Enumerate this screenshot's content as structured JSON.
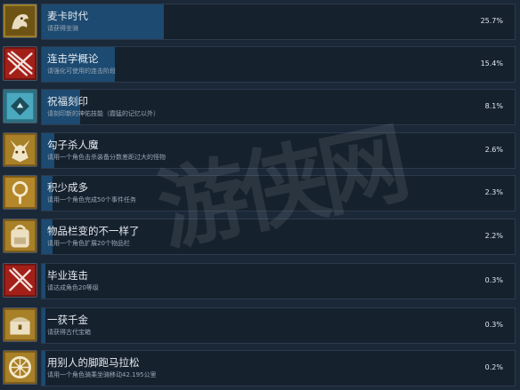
{
  "achievements": [
    {
      "name": "麦卡时代",
      "desc": "请获得坐骑",
      "percent": "25.7%",
      "fill": 0.257,
      "icon": "creature-badge-icon"
    },
    {
      "name": "连击学概论",
      "desc": "请强化可使用的连击阶段",
      "percent": "15.4%",
      "fill": 0.154,
      "icon": "crossed-claws-icon"
    },
    {
      "name": "祝福刻印",
      "desc": "请刻印新的神佑技能（霞猛的记忆以外）",
      "percent": "8.1%",
      "fill": 0.081,
      "icon": "rune-tile-icon"
    },
    {
      "name": "勾子杀人魔",
      "desc": "请用一个角色击杀装备分数差距过大的怪物",
      "percent": "2.6%",
      "fill": 0.026,
      "icon": "demon-mask-icon"
    },
    {
      "name": "积少成多",
      "desc": "请用一个角色完成50个事件任务",
      "percent": "2.3%",
      "fill": 0.023,
      "icon": "quest-ring-icon"
    },
    {
      "name": "物品栏变的不一样了",
      "desc": "请用一个角色扩展20个物品栏",
      "percent": "2.2%",
      "fill": 0.022,
      "icon": "backpack-icon"
    },
    {
      "name": "毕业连击",
      "desc": "请达成角色20等级",
      "percent": "0.3%",
      "fill": 0.003,
      "icon": "crossed-swords-icon"
    },
    {
      "name": "一获千金",
      "desc": "请获得古代宝箱",
      "percent": "0.3%",
      "fill": 0.003,
      "icon": "treasure-chest-icon"
    },
    {
      "name": "用别人的脚跑马拉松",
      "desc": "请用一个角色骑乘坐骑移动42.195公里",
      "percent": "0.2%",
      "fill": 0.002,
      "icon": "wheel-icon"
    }
  ],
  "watermark": "游侠网",
  "colors": {
    "background": "#1b2838",
    "bar": "#1c4a71",
    "panel": "#16212e"
  }
}
